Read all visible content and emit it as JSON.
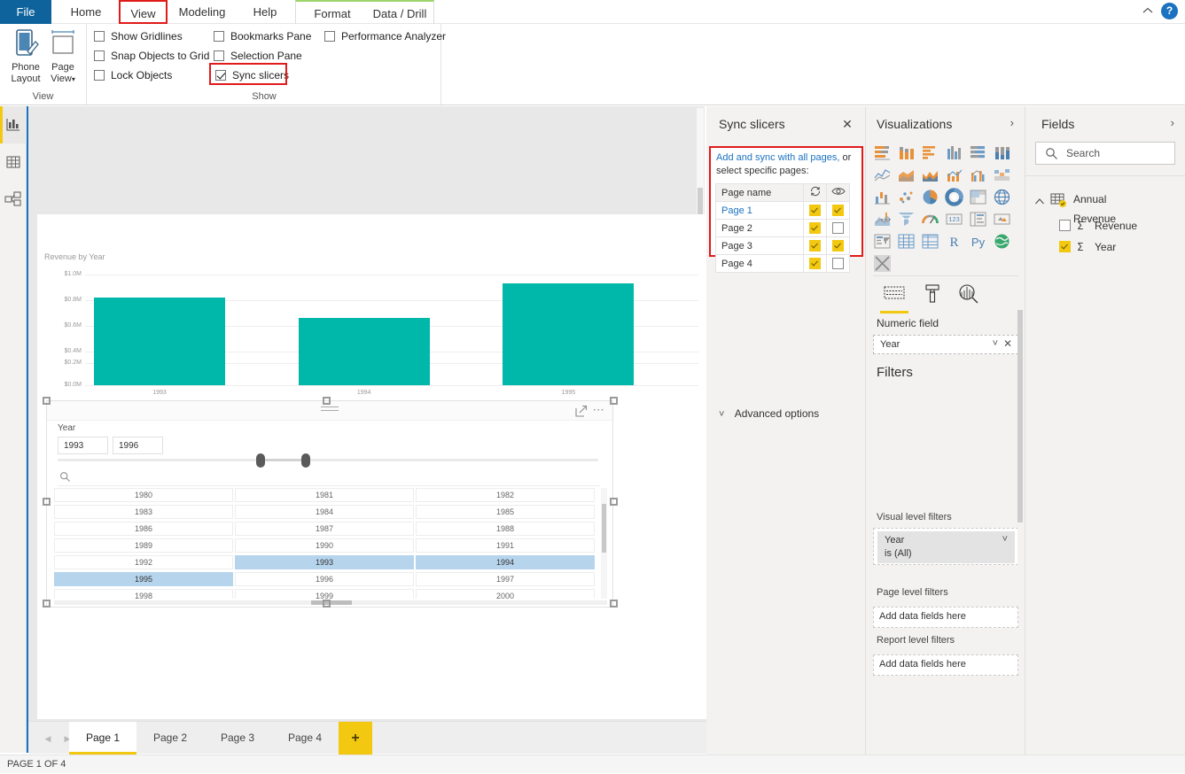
{
  "ribbon": {
    "tabs": [
      {
        "label": "File",
        "kind": "file"
      },
      {
        "label": "Home",
        "kind": "normal"
      },
      {
        "label": "View",
        "kind": "highlighted"
      },
      {
        "label": "Modeling",
        "kind": "normal"
      },
      {
        "label": "Help",
        "kind": "normal"
      },
      {
        "label": "Format",
        "kind": "contextual"
      },
      {
        "label": "Data / Drill",
        "kind": "contextual"
      }
    ],
    "window": {
      "collapse_icon": "chevron-up-icon",
      "help_icon": "help-icon",
      "help_label": "?"
    },
    "groups": [
      {
        "name": "View",
        "label": "View"
      },
      {
        "name": "Show",
        "label": "Show"
      }
    ],
    "big_buttons": [
      {
        "label_line1": "Phone",
        "label_line2": "Layout",
        "icon": "phone-layout-icon"
      },
      {
        "label_line1": "Page",
        "label_line2": "View",
        "icon": "page-view-icon",
        "has_dropdown": true
      }
    ],
    "checkboxes": [
      {
        "label": "Show Gridlines",
        "checked": false,
        "highlighted": false
      },
      {
        "label": "Snap Objects to Grid",
        "checked": false,
        "highlighted": false
      },
      {
        "label": "Lock Objects",
        "checked": false,
        "highlighted": false
      },
      {
        "label": "Bookmarks Pane",
        "checked": false,
        "highlighted": false
      },
      {
        "label": "Selection Pane",
        "checked": false,
        "highlighted": false
      },
      {
        "label": "Sync slicers",
        "checked": true,
        "highlighted": true
      },
      {
        "label": "Performance Analyzer",
        "checked": false,
        "highlighted": false
      }
    ]
  },
  "leftnav": {
    "items": [
      {
        "icon": "report-view-icon",
        "selected": true
      },
      {
        "icon": "data-view-icon",
        "selected": false
      },
      {
        "icon": "model-view-icon",
        "selected": false
      }
    ]
  },
  "chart_data": {
    "type": "bar",
    "title": "Revenue by Year",
    "categories": [
      "1993",
      "1994",
      "1995"
    ],
    "values": [
      0.79,
      0.61,
      0.92
    ],
    "xlabel": "",
    "ylabel": "",
    "ylim": [
      0,
      1.0
    ],
    "ytick_labels": [
      "$1.0M",
      "$0.8M",
      "$0.6M",
      "$0.4M",
      "$0.2M",
      "$0.0M"
    ],
    "ytick_values": [
      1.0,
      0.8,
      0.6,
      0.4,
      0.2,
      0.0
    ],
    "bar_color": "#00b8aa",
    "grid": true,
    "legend": "none"
  },
  "slicer": {
    "field_label": "Year",
    "range_min": "1993",
    "range_max": "1996",
    "search_icon": "search-icon",
    "drag_icon": "drag-handle-icon",
    "focus_icon": "focus-mode-icon",
    "more_icon": "more-options-icon",
    "years": [
      {
        "value": "1980",
        "selected": false
      },
      {
        "value": "1981",
        "selected": false
      },
      {
        "value": "1982",
        "selected": false
      },
      {
        "value": "1983",
        "selected": false
      },
      {
        "value": "1984",
        "selected": false
      },
      {
        "value": "1985",
        "selected": false
      },
      {
        "value": "1986",
        "selected": false
      },
      {
        "value": "1987",
        "selected": false
      },
      {
        "value": "1988",
        "selected": false
      },
      {
        "value": "1989",
        "selected": false
      },
      {
        "value": "1990",
        "selected": false
      },
      {
        "value": "1991",
        "selected": false
      },
      {
        "value": "1992",
        "selected": false
      },
      {
        "value": "1993",
        "selected": true
      },
      {
        "value": "1994",
        "selected": true
      },
      {
        "value": "1995",
        "selected": true
      },
      {
        "value": "1996",
        "selected": false
      },
      {
        "value": "1997",
        "selected": false
      },
      {
        "value": "1998",
        "selected": false
      },
      {
        "value": "1999",
        "selected": false
      },
      {
        "value": "2000",
        "selected": false
      }
    ]
  },
  "pagetabs": {
    "prev_icon": "chevron-left-icon",
    "next_icon": "chevron-right-icon",
    "tabs": [
      {
        "label": "Page 1",
        "active": true
      },
      {
        "label": "Page 2",
        "active": false
      },
      {
        "label": "Page 3",
        "active": false
      },
      {
        "label": "Page 4",
        "active": false
      }
    ],
    "add_label": "+"
  },
  "statusbar": {
    "text": "PAGE 1 OF 4"
  },
  "sync_pane": {
    "title": "Sync slicers",
    "close_icon": "close-icon",
    "description_line1": "Add and sync with all pages,",
    "description_line2": "or select specific pages:",
    "table": {
      "header_name": "Page name",
      "header_sync_icon": "sync-icon",
      "header_visible_icon": "eye-icon",
      "rows": [
        {
          "name": "Page 1",
          "sync": true,
          "visible": true,
          "current": true
        },
        {
          "name": "Page 2",
          "sync": true,
          "visible": false,
          "current": false
        },
        {
          "name": "Page 3",
          "sync": true,
          "visible": true,
          "current": false
        },
        {
          "name": "Page 4",
          "sync": true,
          "visible": false,
          "current": false
        }
      ]
    },
    "advanced_options": "Advanced options",
    "advanced_chevron": "chevron-down-icon"
  },
  "viz_pane": {
    "title": "Visualizations",
    "chevron_icon": "chevron-right-icon",
    "icons": [
      "stacked-bar-chart-icon",
      "stacked-column-chart-icon",
      "clustered-bar-chart-icon",
      "clustered-column-chart-icon",
      "100-stacked-bar-chart-icon",
      "100-stacked-column-chart-icon",
      "line-chart-icon",
      "area-chart-icon",
      "stacked-area-chart-icon",
      "line-stacked-column-icon",
      "line-clustered-column-icon",
      "ribbon-chart-icon",
      "waterfall-chart-icon",
      "scatter-chart-icon",
      "pie-chart-icon",
      "donut-chart-icon",
      "treemap-icon",
      "map-icon",
      "filled-map-icon",
      "funnel-icon",
      "gauge-icon",
      "card-icon",
      "multi-row-card-icon",
      "kpi-icon",
      "slicer-icon",
      "table-icon",
      "matrix-icon",
      "r-script-visual-icon",
      "python-visual-icon",
      "arcgis-map-icon",
      "key-influencers-icon"
    ],
    "more_visuals_icon": "more-visuals-icon",
    "field_tabs": [
      {
        "icon": "fields-tab-icon",
        "selected": true
      },
      {
        "icon": "format-paint-roller-icon",
        "selected": false
      },
      {
        "icon": "analytics-magnifier-icon",
        "selected": false
      }
    ],
    "well_label": "Numeric field",
    "well_value": "Year",
    "well_chevron_icon": "chevron-down-icon",
    "well_remove_icon": "close-icon"
  },
  "filters": {
    "title": "Filters",
    "visual_level_label": "Visual level filters",
    "visual_filter": {
      "field": "Year",
      "condition": "is (All)",
      "chevron_icon": "chevron-down-icon"
    },
    "page_level_label": "Page level filters",
    "page_level_placeholder": "Add data fields here",
    "report_level_label": "Report level filters",
    "report_level_placeholder": "Add data fields here"
  },
  "fields_pane": {
    "title": "Fields",
    "chevron_icon": "chevron-right-icon",
    "search_icon": "search-icon",
    "search_placeholder": "Search",
    "table": {
      "name": "Annual Revenue",
      "expand_icon": "chevron-up-icon",
      "table-icon": "table-icon",
      "checked": true,
      "fields": [
        {
          "name": "Revenue",
          "checked": false,
          "aggregate": "Σ"
        },
        {
          "name": "Year",
          "checked": true,
          "aggregate": "Σ"
        }
      ]
    }
  },
  "colors": {
    "accent_yellow": "#f2c811",
    "brand_blue": "#0e639c",
    "highlight_red": "#e11a1a",
    "chart_teal": "#00b8aa",
    "selection_blue": "#b6d4ec"
  }
}
